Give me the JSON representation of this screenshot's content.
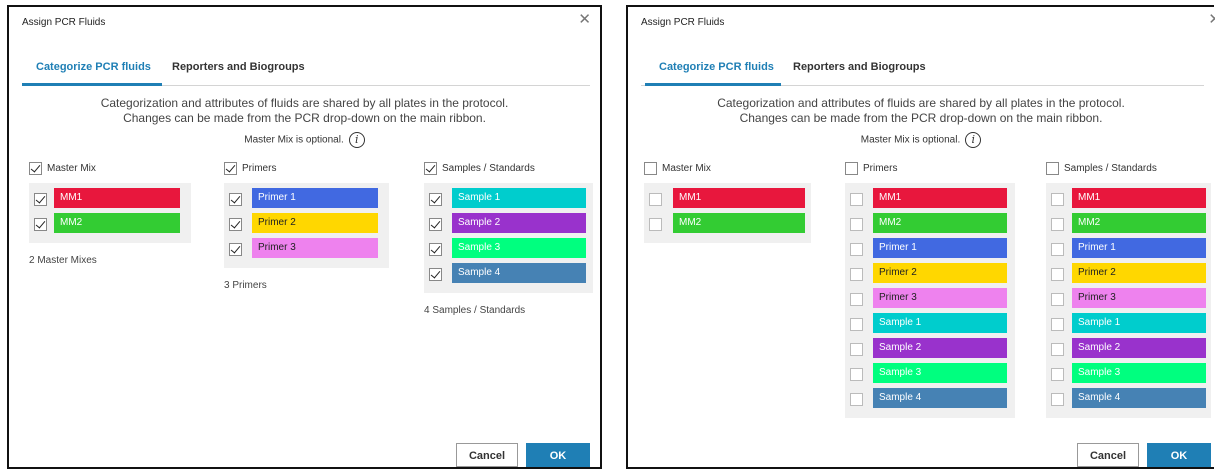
{
  "dialog_title": "Assign PCR Fluids",
  "tabs": [
    "Categorize PCR fluids",
    "Reporters and Biogroups"
  ],
  "info": {
    "line1": "Categorization and attributes of fluids are shared by all plates in the protocol.",
    "line2": "Changes can be made from the PCR drop-down on the main ribbon.",
    "optional_note": "Master Mix is optional.",
    "info_icon": "i"
  },
  "buttons": {
    "cancel": "Cancel",
    "ok": "OK"
  },
  "colors": {
    "accent": "#1f7fb5",
    "MM1": "#e8173d",
    "MM2": "#33cc33",
    "Primer 1": "#4169e1",
    "Primer 2": "#ffd700",
    "Primer 3": "#ee82ee",
    "Sample 1": "#00cdcd",
    "Sample 2": "#9932cc",
    "Sample 3": "#00ff7f",
    "Sample 4": "#4682b4"
  },
  "left_dialog": {
    "columns": [
      {
        "header": "Master Mix",
        "checked": true,
        "items": [
          "MM1",
          "MM2"
        ],
        "count": "2 Master Mixes"
      },
      {
        "header": "Primers",
        "checked": true,
        "items": [
          "Primer 1",
          "Primer 2",
          "Primer 3"
        ],
        "count": "3 Primers"
      },
      {
        "header": "Samples / Standards",
        "checked": true,
        "items": [
          "Sample 1",
          "Sample 2",
          "Sample 3",
          "Sample 4"
        ],
        "count": "4 Samples / Standards"
      }
    ]
  },
  "right_dialog": {
    "columns": [
      {
        "header": "Master Mix",
        "checked": false,
        "items": [
          "MM1",
          "MM2"
        ]
      },
      {
        "header": "Primers",
        "checked": false,
        "items": [
          "MM1",
          "MM2",
          "Primer 1",
          "Primer 2",
          "Primer 3",
          "Sample 1",
          "Sample 2",
          "Sample 3",
          "Sample 4"
        ]
      },
      {
        "header": "Samples / Standards",
        "checked": false,
        "items": [
          "MM1",
          "MM2",
          "Primer 1",
          "Primer 2",
          "Primer 3",
          "Sample 1",
          "Sample 2",
          "Sample 3",
          "Sample 4"
        ]
      }
    ]
  }
}
